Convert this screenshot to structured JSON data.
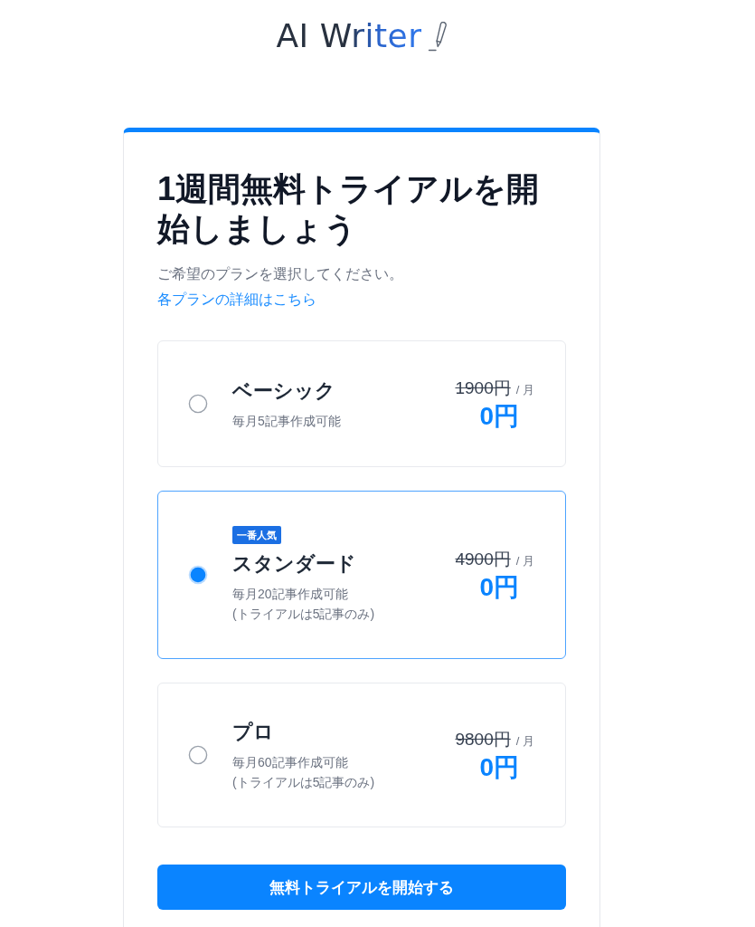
{
  "header": {
    "logo": "AI Writer"
  },
  "card": {
    "title": "1週間無料トライアルを開始しましょう",
    "subtitle": "ご希望のプランを選択してください。",
    "details_link": "各プランの詳細はこちら",
    "plans": [
      {
        "name": "ベーシック",
        "description": [
          "毎月5記事作成可能"
        ],
        "original_price": "1900円",
        "period": "/ 月",
        "price": "0円",
        "selected": false
      },
      {
        "badge": "一番人気",
        "name": "スタンダード",
        "description": [
          "毎月20記事作成可能",
          "(トライアルは5記事のみ)"
        ],
        "original_price": "4900円",
        "period": "/ 月",
        "price": "0円",
        "selected": true
      },
      {
        "name": "プロ",
        "description": [
          "毎月60記事作成可能",
          "(トライアルは5記事のみ)"
        ],
        "original_price": "9800円",
        "period": "/ 月",
        "price": "0円",
        "selected": false
      }
    ],
    "button": "無料トライアルを開始する"
  }
}
